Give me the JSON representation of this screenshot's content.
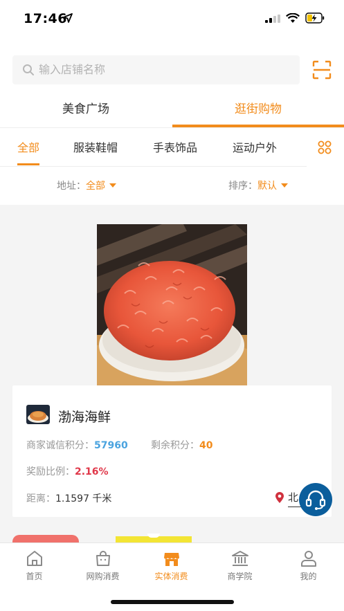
{
  "status_bar": {
    "time": "17:46"
  },
  "search": {
    "placeholder": "输入店铺名称"
  },
  "main_tabs": [
    {
      "label": "美食广场"
    },
    {
      "label": "逛街购物"
    }
  ],
  "category_tabs": [
    {
      "label": "全部"
    },
    {
      "label": "服装鞋帽"
    },
    {
      "label": "手表饰品"
    },
    {
      "label": "运动户外"
    }
  ],
  "filters": {
    "address_label": "地址：",
    "address_value": "全部",
    "sort_label": "排序：",
    "sort_value": "默认"
  },
  "shop": {
    "name": "渤海海鲜",
    "credit_label": "商家诚信积分：",
    "credit_value": "57960",
    "remaining_label": "剩余积分：",
    "remaining_value": "40",
    "reward_label": "奖励比例：",
    "reward_value": "2.16%",
    "distance_label": "距离：",
    "distance_value": "1.1597 千米",
    "location_text": "北"
  },
  "tab_bar": [
    {
      "label": "首页",
      "icon": "home-icon"
    },
    {
      "label": "网购消费",
      "icon": "shopping-bag-icon"
    },
    {
      "label": "实体消费",
      "icon": "store-icon"
    },
    {
      "label": "商学院",
      "icon": "bank-icon"
    },
    {
      "label": "我的",
      "icon": "user-icon"
    }
  ],
  "colors": {
    "accent": "#f28c1c",
    "credit_blue": "#4aa3df",
    "reward_red": "#e0384a",
    "support_button": "#0b5e9c"
  }
}
